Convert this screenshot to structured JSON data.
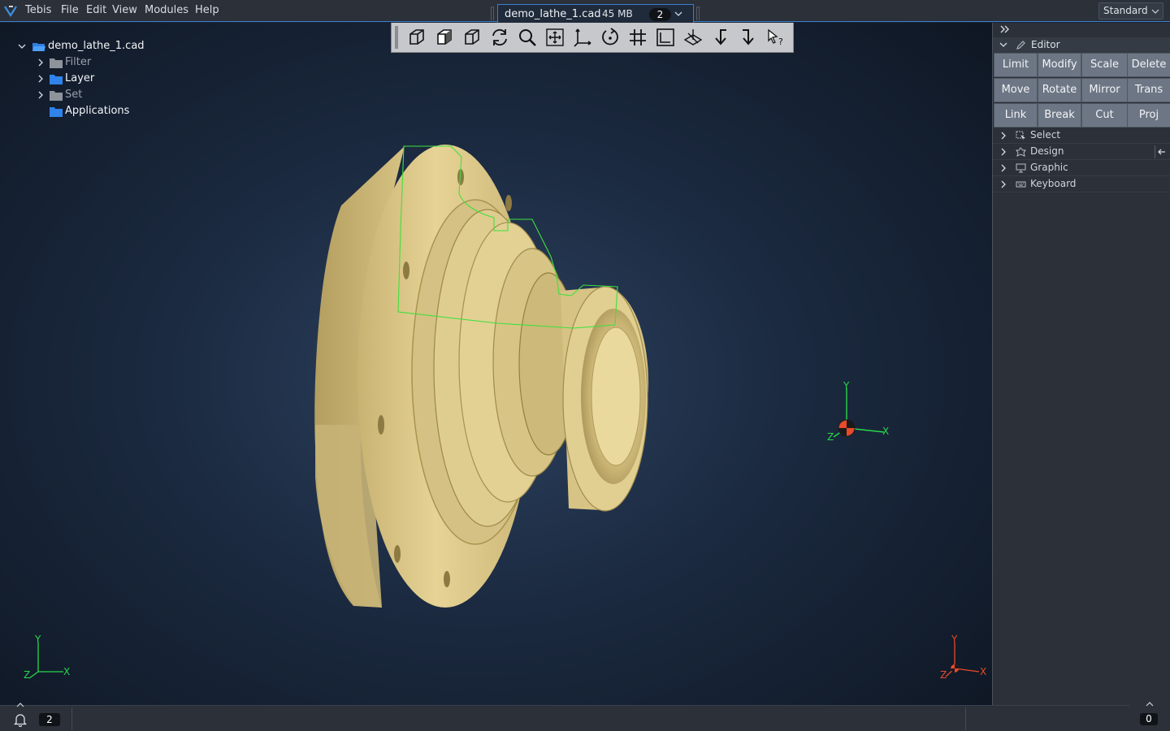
{
  "menubar": {
    "logo_icon": "tebis-logo-icon",
    "items": [
      "Tebis",
      "File",
      "Edit",
      "View",
      "Modules",
      "Help"
    ]
  },
  "document_tab": {
    "name": "demo_lathe_1.cad",
    "size": "45 MB",
    "badge": "2"
  },
  "layout_select": {
    "value": "Standard"
  },
  "tree": {
    "root": "demo_lathe_1.cad",
    "items": [
      {
        "label": "Filter",
        "expandable": true,
        "enabled": false
      },
      {
        "label": "Layer",
        "expandable": true,
        "enabled": true
      },
      {
        "label": "Set",
        "expandable": true,
        "enabled": false
      },
      {
        "label": "Applications",
        "expandable": false,
        "enabled": true
      }
    ]
  },
  "toolbar": {
    "tools": [
      "view-iso-icon",
      "view-solid-icon",
      "view-wire-icon",
      "regenerate-icon",
      "zoom-icon",
      "pan-icon",
      "axis-icon",
      "rotate-icon",
      "grid-icon",
      "frame-icon",
      "plane-icon",
      "back-arrow-icon",
      "forward-arrow-icon",
      "select-help-icon"
    ]
  },
  "panel": {
    "editor": {
      "title": "Editor",
      "buttons": [
        "Limit",
        "Modify",
        "Scale",
        "Delete",
        "Move",
        "Rotate",
        "Mirror",
        "Trans",
        "Link",
        "Break",
        "Cut",
        "Proj"
      ]
    },
    "sections": [
      "Select",
      "Design",
      "Graphic",
      "Keyboard"
    ]
  },
  "axes": {
    "x": "X",
    "y": "Y",
    "z": "Z"
  },
  "statusbar": {
    "notifications": "2",
    "count": "0"
  },
  "colors": {
    "accent": "#3c7fd0",
    "part": "#d8c584",
    "contour": "#3fe03f",
    "axis_green": "#27d84a",
    "axis_red": "#e84a2a"
  }
}
